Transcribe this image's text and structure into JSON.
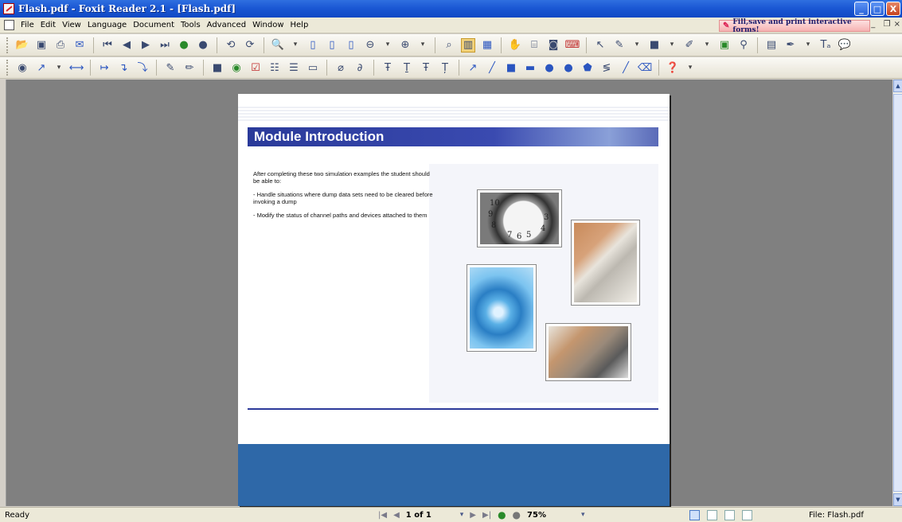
{
  "window": {
    "title": "Flash.pdf - Foxit Reader 2.1 - [Flash.pdf]",
    "minimize_glyph": "_",
    "maximize_glyph": "□",
    "close_glyph": "X"
  },
  "menubar": {
    "items": [
      "File",
      "Edit",
      "View",
      "Language",
      "Document",
      "Tools",
      "Advanced",
      "Window",
      "Help"
    ],
    "promo_text": "Fill,save and print interactive forms!",
    "mdi_minimize": "_",
    "mdi_restore": "  ❐",
    "mdi_close": "×"
  },
  "toolbar1": {
    "icons": [
      "open-icon",
      "save-icon",
      "print-icon",
      "email-icon",
      "first-page-icon",
      "prev-page-icon",
      "next-page-icon",
      "last-page-icon",
      "go-back-icon",
      "go-forward-icon",
      "rotate-left-icon",
      "rotate-right-icon",
      "zoom-in-icon",
      "single-page-icon",
      "continuous-icon",
      "facing-icon",
      "zoom-out-icon",
      "zoom-in-plus-icon",
      "find-icon",
      "bookmark-icon",
      "thumbnail-icon",
      "hand-icon",
      "select-text-icon",
      "snapshot-icon",
      "typewriter-icon",
      "select-annot-icon",
      "note-icon",
      "rectangle-icon",
      "pencil-icon",
      "image-icon",
      "search-icon",
      "form-icon",
      "highlight-icon",
      "text-tool-icon",
      "comment-icon"
    ]
  },
  "toolbar2": {
    "icons": [
      "select-icon",
      "arrow-icon",
      "distance-icon",
      "callout-icon",
      "polyline-icon",
      "strikeout-icon",
      "edit-icon",
      "erase-icon",
      "textbox-icon",
      "radio-icon",
      "checkbox-icon",
      "listbox-icon",
      "combo-icon",
      "button-icon",
      "attach-icon",
      "link-icon",
      "highlight-text-icon",
      "underline-icon",
      "strike-text-icon",
      "squiggly-icon",
      "line-arrow-icon",
      "line-icon",
      "square-icon",
      "rect-fill-icon",
      "circle-icon",
      "ellipse-icon",
      "polygon-icon",
      "cloud-icon",
      "pencil-draw-icon",
      "eraser-icon",
      "help-icon"
    ]
  },
  "document": {
    "heading": "Module Introduction",
    "intro": "After completing these two simulation examples the student should be able to:",
    "bullets": [
      "- Handle situations where dump data sets need to be cleared before invoking a dump",
      "- Modify the status of channel paths and devices attached to them"
    ],
    "images": [
      "clock-photo",
      "keyboard-photo",
      "globe-photo",
      "mouse-photo"
    ],
    "clock_numerals": [
      "10",
      "9",
      "8",
      "7",
      "6",
      "5",
      "4",
      "3"
    ]
  },
  "statusbar": {
    "status": "Ready",
    "page_field": "1 of 1",
    "zoom_field": "75%",
    "file_label": "File: Flash.pdf"
  },
  "colors": {
    "titlebar": "#1b58d4",
    "header_band": "#2a3a9a",
    "footer_band": "#2e68a8",
    "doc_background": "#808080"
  }
}
